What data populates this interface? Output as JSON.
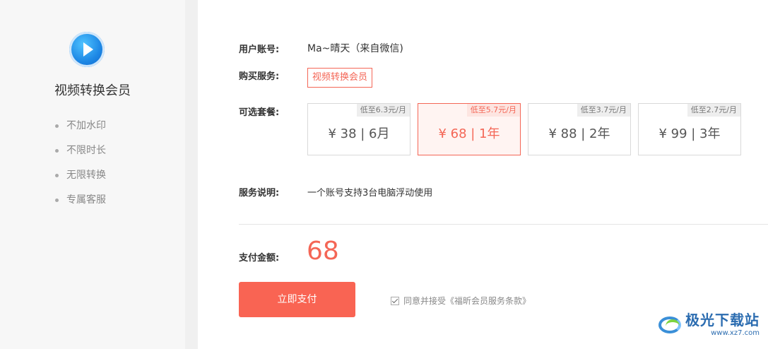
{
  "sidebar": {
    "app_title": "视频转换会员",
    "features": [
      "不加水印",
      "不限时长",
      "无限转换",
      "专属客服"
    ]
  },
  "account": {
    "label": "用户账号:",
    "value": "Ma~晴天（来自微信)"
  },
  "service": {
    "label": "购买服务:",
    "tag": "视频转换会员"
  },
  "plans": {
    "label": "可选套餐:",
    "selected_index": 1,
    "items": [
      {
        "badge": "低至6.3元/月",
        "price": "¥ 38 | 6月"
      },
      {
        "badge": "低至5.7元/月",
        "price": "¥ 68 | 1年"
      },
      {
        "badge": "低至3.7元/月",
        "price": "¥ 88 | 2年"
      },
      {
        "badge": "低至2.7元/月",
        "price": "¥ 99 | 3年"
      }
    ]
  },
  "description": {
    "label": "服务说明:",
    "value": "一个账号支持3台电脑浮动使用"
  },
  "payment": {
    "label": "支付金额:",
    "amount": "68",
    "button": "立即支付",
    "agreement": "同意并接受《福昕会员服务条款》",
    "agreement_checked": true
  },
  "watermark": {
    "cn": "极光下载站",
    "en": "www.xz7.com"
  },
  "colors": {
    "accent": "#f46656",
    "button": "#f96453",
    "app_logo": "#1e88e5"
  }
}
